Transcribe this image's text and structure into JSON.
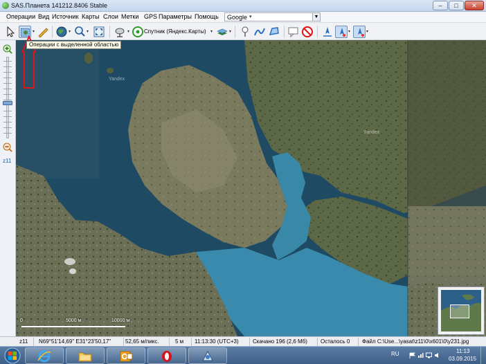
{
  "window": {
    "title": "SAS.Планета 141212.8406 Stable",
    "minimize_glyph": "–",
    "maximize_glyph": "□",
    "close_glyph": "✕"
  },
  "menu": {
    "items": [
      "Операции",
      "Вид",
      "Источник",
      "Карты",
      "Слои",
      "Метки",
      "GPS",
      "Параметры",
      "Помощь"
    ],
    "map_select": {
      "value": "Google",
      "arrow": "▾"
    }
  },
  "toolbar": {
    "dropdown_glyph": "▾",
    "satellite_label": "Спутник (Яндекс.Карты)",
    "tooltip": "Операции с выделенной областью",
    "icons": [
      "cursor-icon",
      "select-area-icon",
      "ruler-icon",
      "globe-icon",
      "zoom-magnifier-icon",
      "fullscreen-icon",
      "satellite-dish-icon",
      "gps-green-icon",
      "layers-icon",
      "placemark-icon",
      "path-icon",
      "polygon-icon",
      "comment-icon",
      "no-entry-icon",
      "navigation-arrow-icon"
    ]
  },
  "map": {
    "watermarks": [
      "Yandex",
      "Yandex"
    ],
    "scale_labels": [
      "0",
      "5000 м",
      "10000 м"
    ]
  },
  "zoom": {
    "level_label": "z11",
    "in_glyph": "+",
    "out_glyph": "−"
  },
  "status": {
    "zoom": "z11",
    "coordinates": "N69°51'14,69\" E31°23'50,17\"",
    "resolution": "52,65 м/пикс.",
    "elevation": "5 м",
    "time": "11:13:30 (UTC+3)",
    "downloaded": "Скачано 196 (2,6 Мб)",
    "remaining": "Осталось 0",
    "file": "Файл C:\\Use...\\yasat\\z11\\0\\x601\\0\\y231.jpg"
  },
  "taskbar": {
    "language": "RU",
    "time": "11:13",
    "date": "03.09.2015"
  },
  "colors": {
    "selection_blue": "#c9dcf2",
    "annotation_red": "#e1141a",
    "water": "#2d6f96",
    "land": "#5e6a48"
  }
}
